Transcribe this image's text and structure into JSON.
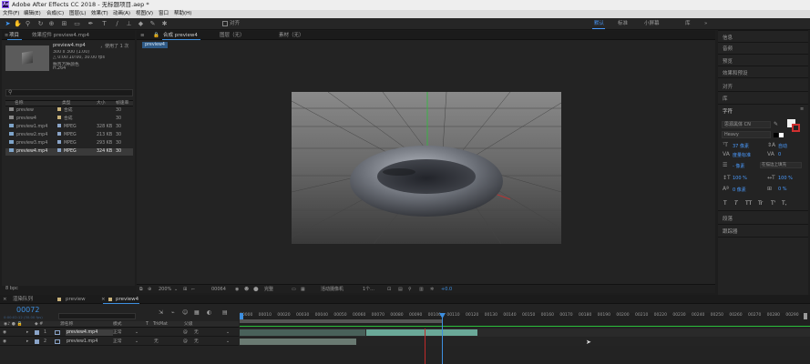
{
  "app": {
    "title": "Adobe After Effects CC 2018 - 无标题项目.aep *",
    "logo_text": "Ae"
  },
  "menu": [
    "文件(F)",
    "编辑(E)",
    "合成(C)",
    "图层(L)",
    "效果(T)",
    "动画(A)",
    "视图(V)",
    "窗口",
    "帮助(H)"
  ],
  "toolbar": {
    "align_label": "对齐",
    "workspaces": [
      "默认",
      "标准",
      "小屏幕",
      "库"
    ],
    "active_workspace": "默认"
  },
  "project_panel": {
    "tabs": [
      "项目",
      "效果控件 preview4.mp4"
    ],
    "selected_item": "preview4.mp4",
    "selected_usage": "，使用了 1 次",
    "meta_lines": [
      "300 x 300 (1.00)",
      "△ 0:00:10:00, 30.00 fps",
      "数百万种颜色",
      "H.264"
    ],
    "search_placeholder": "",
    "columns": [
      "名称",
      "类型",
      "大小",
      "帧速率"
    ],
    "files": [
      {
        "name": "preview",
        "type": "合成",
        "size": "",
        "fps": "30",
        "kind": "comp",
        "color": "#c9b27a"
      },
      {
        "name": "preview4",
        "type": "合成",
        "size": "",
        "fps": "30",
        "kind": "comp",
        "color": "#c9b27a"
      },
      {
        "name": "preview1.mp4",
        "type": "MPEG",
        "size": "328 KB",
        "fps": "30",
        "kind": "video",
        "color": "#8aa4c8"
      },
      {
        "name": "preview2.mp4",
        "type": "MPEG",
        "size": "213 KB",
        "fps": "30",
        "kind": "video",
        "color": "#8aa4c8"
      },
      {
        "name": "preview3.mp4",
        "type": "MPEG",
        "size": "293 KB",
        "fps": "30",
        "kind": "video",
        "color": "#8aa4c8"
      },
      {
        "name": "preview4.mp4",
        "type": "MPEG",
        "size": "324 KB",
        "fps": "30",
        "kind": "video",
        "color": "#8aa4c8",
        "selected": true
      }
    ],
    "bpc": "8 bpc"
  },
  "viewer": {
    "tabs": [
      "合成 preview4",
      "图层（无）",
      "素材（无）"
    ],
    "breadcrumb": "preview4",
    "controls": {
      "zoom": "200%",
      "timecode": "00064",
      "resolution": "完整",
      "camera": "活动摄像机",
      "views": "1个...",
      "exposure": "+0.0"
    }
  },
  "right_panel": {
    "items_top": [
      "信息",
      "音频",
      "预览",
      "效果和预设",
      "对齐",
      "库"
    ],
    "character_label": "字符",
    "font_name": "思源黑体 CN",
    "font_style": "Heavy",
    "size": "37 像素",
    "leading": "自动",
    "tracking": "度量标准",
    "kerning_value": "0",
    "stroke": "- 像素",
    "stroke_mode": "在描边上填充",
    "vert_scale": "100 %",
    "horz_scale": "100 %",
    "baseline": "0 像素",
    "tsume": "0 %",
    "type_buttons": [
      "T",
      "T",
      "TT",
      "Tr",
      "T'",
      "T,"
    ],
    "items_bottom": [
      "段落",
      "跟踪器"
    ]
  },
  "timeline": {
    "tabs": [
      "渲染队列",
      "preview",
      "preview4"
    ],
    "timecode": "00072",
    "timecode_sub": "0:00:02:12 (30.00 fps)",
    "columns": [
      "源名称",
      "模式",
      "T",
      "TrkMat",
      "父级"
    ],
    "layers": [
      {
        "num": "1",
        "name": "preview4.mp4",
        "mode": "正常",
        "trkmat": "",
        "parent": "无"
      },
      {
        "num": "2",
        "name": "preview1.mp4",
        "mode": "正常",
        "trkmat": "无",
        "parent": "无"
      }
    ],
    "ruler_ticks": [
      "00000",
      "00010",
      "00020",
      "00030",
      "00040",
      "00050",
      "00060",
      "00070",
      "00080",
      "00090",
      "00100",
      "00110",
      "00120",
      "00130",
      "00140",
      "00150",
      "00160",
      "00170",
      "00180",
      "00190",
      "00200",
      "00210",
      "00220",
      "00230",
      "00240",
      "00250",
      "00260",
      "00270",
      "00280",
      "00290"
    ]
  }
}
